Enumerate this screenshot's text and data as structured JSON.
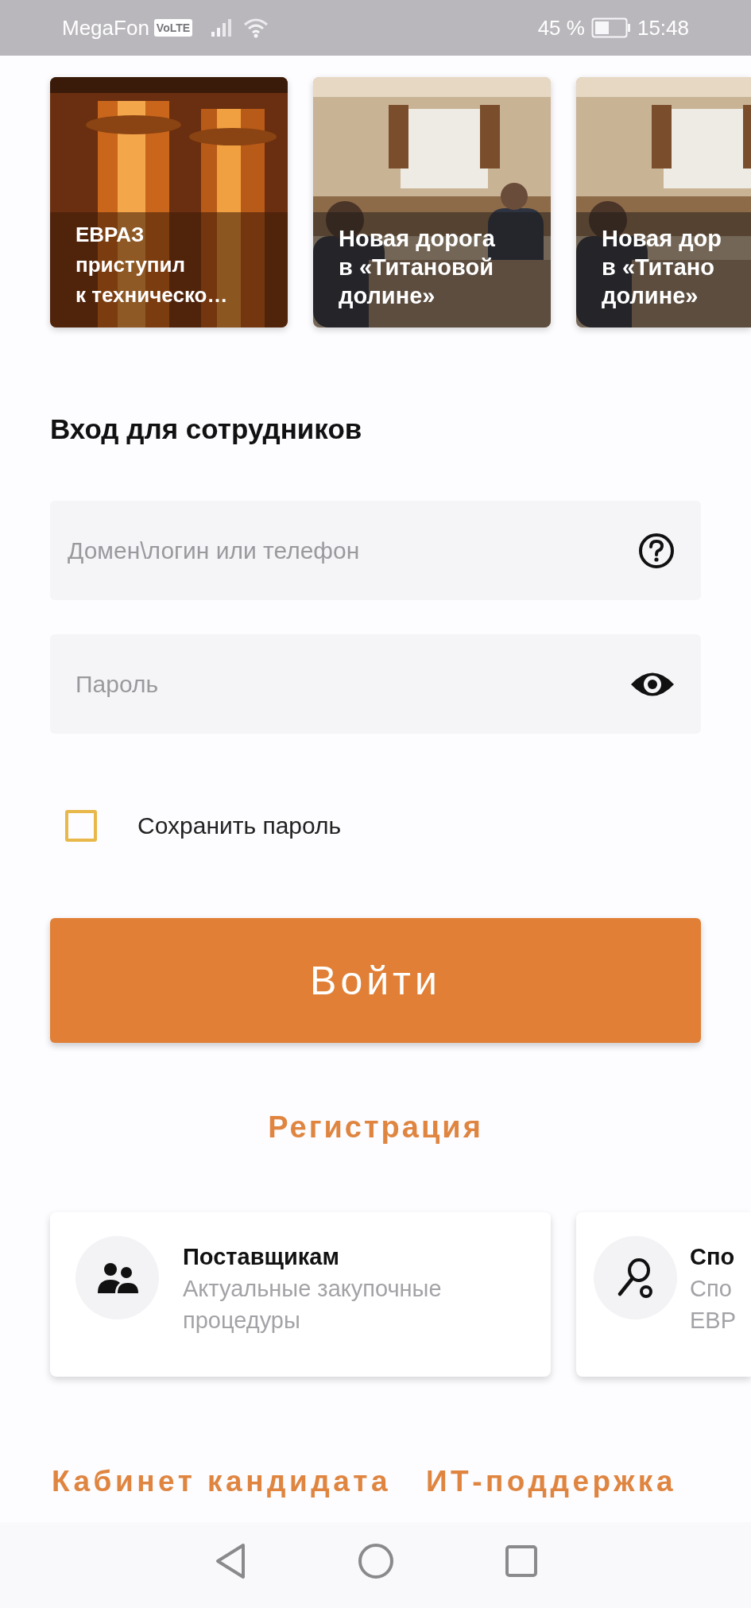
{
  "status_bar": {
    "carrier": "MegaFon",
    "volte_badge": "VoLTE",
    "battery_text": "45 %",
    "time": "15:48"
  },
  "news": [
    {
      "kind": "picture",
      "title": "ЕВРАЗ\nприступил\nк техническо…"
    },
    {
      "kind": "picture",
      "title": "Новая дорога\nв «Титановой\nдолине»"
    },
    {
      "kind": "picture",
      "title": "Новая дор\nв «Титано\nдолине»"
    }
  ],
  "login": {
    "title": "Вход для сотрудников",
    "fields": [
      {
        "kind": "login",
        "placeholder": "Домен\\логин или телефон"
      },
      {
        "kind": "password",
        "placeholder": "Пароль"
      }
    ],
    "remember": {
      "label": "Сохранить пароль",
      "checked": false
    },
    "submit": "Войти",
    "register": "Регистрация"
  },
  "services": [
    {
      "kind": "suppliers",
      "title": "Поставщикам",
      "subtitle": "Актуальные закупочные\nпроцедуры"
    },
    {
      "kind": "sport",
      "title": "Спо",
      "subtitle": "Спо\nЕВР"
    }
  ],
  "links": [
    "Кабинет кандидата",
    "ИТ-поддержка"
  ]
}
